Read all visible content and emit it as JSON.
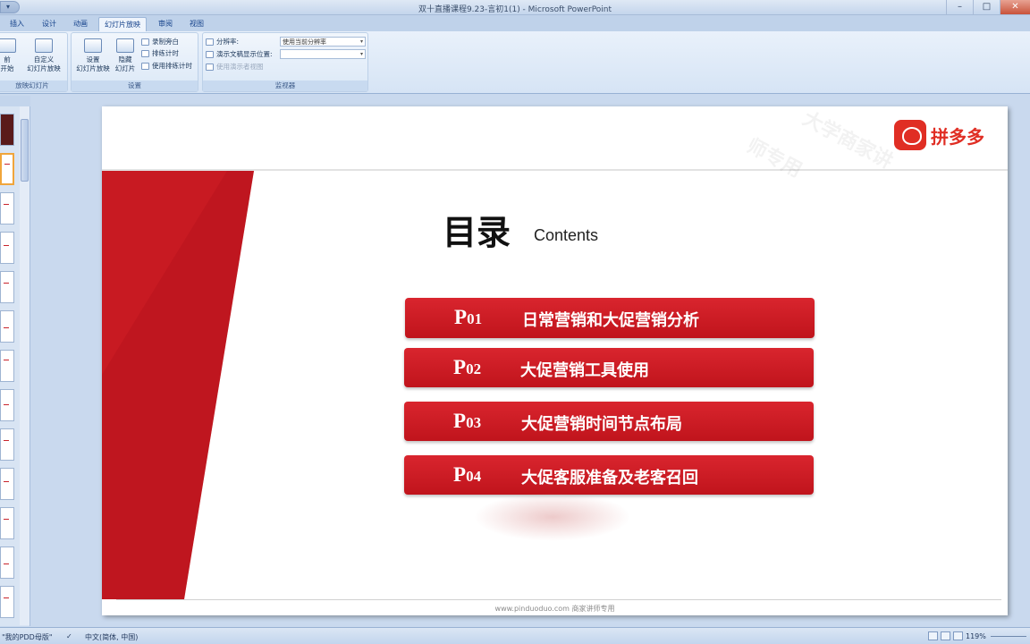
{
  "window": {
    "title": "双十直播课程9.23-言初1(1) - Microsoft PowerPoint"
  },
  "tabs": [
    {
      "label": "插入"
    },
    {
      "label": "设计"
    },
    {
      "label": "动画"
    },
    {
      "label": "幻灯片放映"
    },
    {
      "label": "审阅"
    },
    {
      "label": "视图"
    }
  ],
  "ribbon": {
    "groups": [
      {
        "label": "放映幻灯片"
      },
      {
        "label": "设置"
      },
      {
        "label": "监视器"
      }
    ],
    "start_label_1": "前",
    "start_label_2": "开始",
    "custom_show_1": "自定义",
    "custom_show_2": "幻灯片放映",
    "setup_1": "设置",
    "setup_2": "幻灯片放映",
    "hide_1": "隐藏",
    "hide_2": "幻灯片",
    "record_narration": "录制旁白",
    "rehearse_timings": "排练计时",
    "use_rehearsed_timings": "使用排练计时",
    "resolution_label": "分辨率:",
    "resolution_value": "使用当前分辨率",
    "show_on_label": "演示文稿显示位置:",
    "show_on_value": "",
    "presenter_view": "使用演示者视图"
  },
  "slide": {
    "logo_text": "拼多多",
    "heading": "目录",
    "subheading": "Contents",
    "items": [
      {
        "num": "P",
        "sub": "01",
        "text": "日常营销和大促营销分析"
      },
      {
        "num": "P",
        "sub": "02",
        "text": "大促营销工具使用"
      },
      {
        "num": "P",
        "sub": "03",
        "text": "大促营销时间节点布局"
      },
      {
        "num": "P",
        "sub": "04",
        "text": "大促客服准备及老客召回"
      }
    ],
    "footer": "www.pinduoduo.com 商家讲师专用",
    "watermark_1": "大学商家讲",
    "watermark_2": "师专用"
  },
  "statusbar": {
    "theme": "\"我的PDD母版\"",
    "language": "中文(简体, 中国)",
    "zoom": "119%"
  },
  "colors": {
    "accent": "#d9252e",
    "ribbon": "#dbe8f7"
  }
}
